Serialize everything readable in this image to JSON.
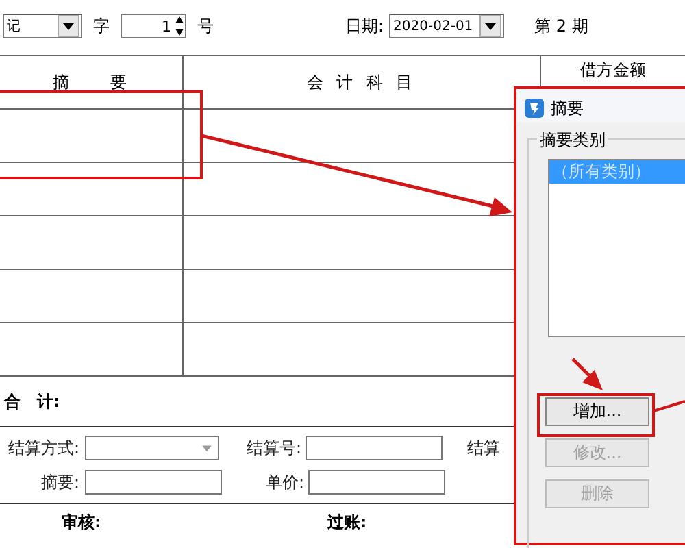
{
  "toolbar": {
    "voucher_type": "记",
    "word_label": "字",
    "number": "1",
    "number_label": "号",
    "date_label": "日期:",
    "date": "2020-02-01",
    "period": "第 2 期"
  },
  "table": {
    "columns": [
      "摘　　要",
      "会 计 科 目",
      "借方金额"
    ]
  },
  "totals_label": "合　计:",
  "settlement": {
    "method_label": "结算方式:",
    "number_label": "结算号:",
    "date_label": "结算",
    "summary_label": "摘要:",
    "price_label": "单价:"
  },
  "footer": [
    "审核:",
    "过账:"
  ],
  "dialog": {
    "title": "摘要",
    "group_label": "摘要类别",
    "list_items": [
      {
        "label": "（所有类别）",
        "selected": true
      }
    ],
    "buttons": [
      {
        "label": "增加...",
        "disabled": false
      },
      {
        "label": "修改...",
        "disabled": true
      },
      {
        "label": "删除",
        "disabled": true
      }
    ]
  }
}
